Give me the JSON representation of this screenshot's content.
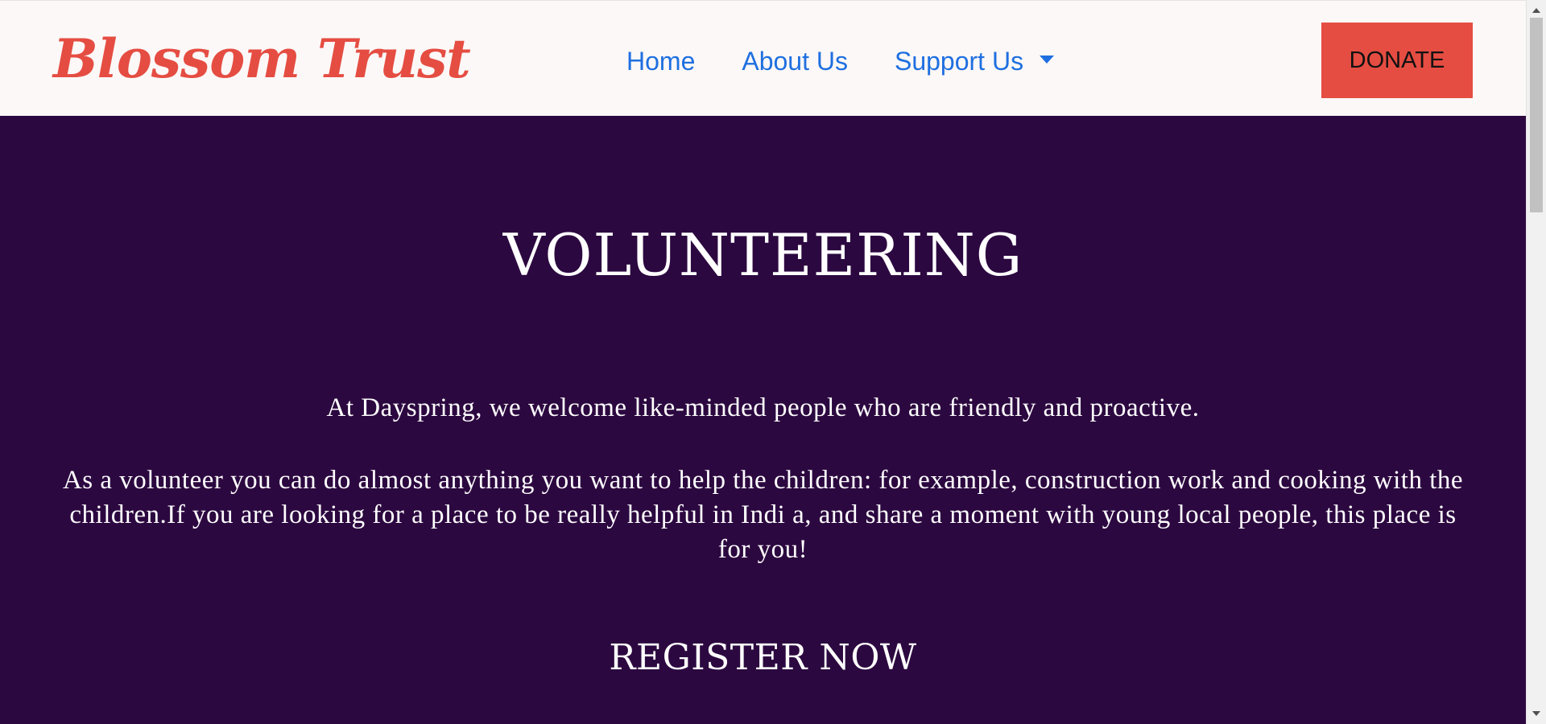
{
  "navbar": {
    "brand": "Blossom Trust",
    "links": [
      {
        "label": "Home"
      },
      {
        "label": "About Us"
      },
      {
        "label": "Support Us",
        "has_dropdown": true
      }
    ],
    "donate_label": "DONATE"
  },
  "content": {
    "title": "VOLUNTEERING",
    "paragraph_1": "At Dayspring, we welcome like-minded people who are friendly and proactive.",
    "paragraph_2": "As a volunteer you can do almost anything you want to help the children: for example, construction work and cooking with the children.If you are looking for a place to be really helpful in Indi a, and share a moment with young local people, this place is for you!",
    "register_label": "REGISTER NOW"
  },
  "colors": {
    "brand": "#e54d42",
    "nav_link": "#1f6fe0",
    "donate_bg": "#e54d42",
    "navbar_bg": "#fcf8f7",
    "hero_bg": "#2c0840",
    "hero_text": "#ffffff"
  },
  "icons": {
    "dropdown": "caret-down-icon"
  }
}
